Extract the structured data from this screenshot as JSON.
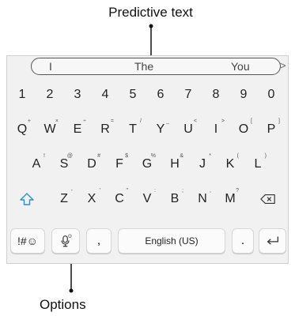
{
  "callouts": {
    "top": "Predictive text",
    "bottom": "Options"
  },
  "suggestions": [
    "I",
    "The",
    "You"
  ],
  "suggest_arrow": ">",
  "rows": {
    "numbers": [
      "1",
      "2",
      "3",
      "4",
      "5",
      "6",
      "7",
      "8",
      "9",
      "0"
    ],
    "row1": [
      {
        "label": "Q",
        "sub": "+"
      },
      {
        "label": "W",
        "sub": "×"
      },
      {
        "label": "E",
        "sub": "÷"
      },
      {
        "label": "R",
        "sub": "="
      },
      {
        "label": "T",
        "sub": "/"
      },
      {
        "label": "Y",
        "sub": "_"
      },
      {
        "label": "U",
        "sub": "<"
      },
      {
        "label": "I",
        "sub": ">"
      },
      {
        "label": "O",
        "sub": "["
      },
      {
        "label": "P",
        "sub": "]"
      }
    ],
    "row2": [
      {
        "label": "A",
        "sub": "!"
      },
      {
        "label": "S",
        "sub": "@"
      },
      {
        "label": "D",
        "sub": "#"
      },
      {
        "label": "F",
        "sub": "$"
      },
      {
        "label": "G",
        "sub": "%"
      },
      {
        "label": "H",
        "sub": "&"
      },
      {
        "label": "J",
        "sub": "*"
      },
      {
        "label": "K",
        "sub": "("
      },
      {
        "label": "L",
        "sub": ")"
      }
    ],
    "row3": [
      {
        "label": "Z",
        "sub": "-"
      },
      {
        "label": "X",
        "sub": "'"
      },
      {
        "label": "C",
        "sub": "\""
      },
      {
        "label": "V",
        "sub": ":"
      },
      {
        "label": "B",
        "sub": ";"
      },
      {
        "label": "N",
        "sub": ","
      },
      {
        "label": "M",
        "sub": "?"
      }
    ]
  },
  "bottom_row": {
    "symbols": "!#☺",
    "comma": ",",
    "space": "English (US)",
    "period": "."
  },
  "icons": {
    "shift": "shift-icon",
    "backspace": "backspace-icon",
    "mic": "microphone-icon",
    "enter": "enter-icon"
  },
  "colors": {
    "accent": "#2a8fd6"
  }
}
